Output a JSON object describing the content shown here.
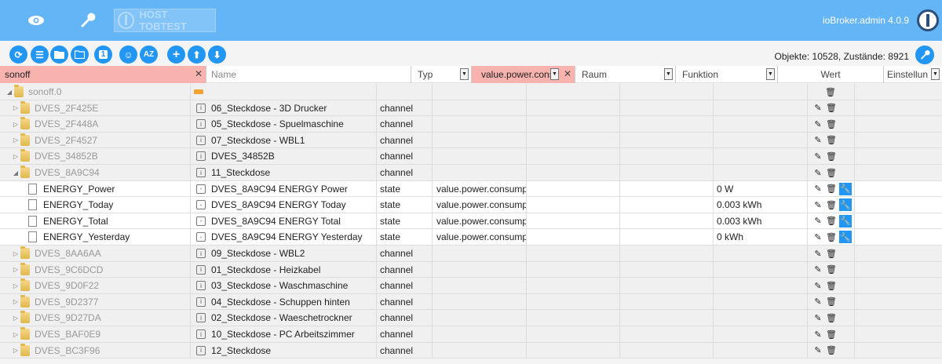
{
  "header": {
    "host_label": "HOST TOBTEST",
    "version": "ioBroker.admin 4.0.9",
    "icons": [
      "eye-icon",
      "wrench-icon"
    ]
  },
  "toolbar": {
    "buttons": [
      "refresh-icon",
      "list-icon",
      "folder-icon",
      "folder-outline-icon",
      "one-icon",
      "user-settings-icon",
      "sort-az-icon",
      "add-icon",
      "upload-icon",
      "download-icon"
    ],
    "sort_label": "AZ",
    "one_label": "1",
    "stats": "Objekte: 10528, Zustände: 8921"
  },
  "filters": {
    "id_value": "sonoff",
    "name_placeholder": "Name",
    "type_label": "Typ",
    "role_value": "value.power.consu",
    "room_label": "Raum",
    "function_label": "Funktion",
    "value_label": "Wert",
    "settings_label": "Einstellun"
  },
  "root": {
    "id": "sonoff.0"
  },
  "rows": [
    {
      "id": "DVES_2F425E",
      "name": "06_Steckdose - 3D Drucker",
      "type": "channel",
      "role": "",
      "value": "",
      "kind": "folder",
      "expanded": false
    },
    {
      "id": "DVES_2F448A",
      "name": "05_Steckdose - Spuelmaschine",
      "type": "channel",
      "role": "",
      "value": "",
      "kind": "folder",
      "expanded": false
    },
    {
      "id": "DVES_2F4527",
      "name": "07_Steckdose - WBL1",
      "type": "channel",
      "role": "",
      "value": "",
      "kind": "folder",
      "expanded": false
    },
    {
      "id": "DVES_34852B",
      "name": "DVES_34852B",
      "type": "channel",
      "role": "",
      "value": "",
      "kind": "folder",
      "expanded": false
    },
    {
      "id": "DVES_8A9C94",
      "name": "11_Steckdose",
      "type": "channel",
      "role": "",
      "value": "",
      "kind": "folder",
      "expanded": true
    },
    {
      "id": "ENERGY_Power",
      "name": "DVES_8A9C94 ENERGY Power",
      "type": "state",
      "role": "value.power.consumptio",
      "value": "0 W",
      "kind": "file"
    },
    {
      "id": "ENERGY_Today",
      "name": "DVES_8A9C94 ENERGY Today",
      "type": "state",
      "role": "value.power.consumptio",
      "value": "0.003 kWh",
      "kind": "file"
    },
    {
      "id": "ENERGY_Total",
      "name": "DVES_8A9C94 ENERGY Total",
      "type": "state",
      "role": "value.power.consumptio",
      "value": "0.003 kWh",
      "kind": "file"
    },
    {
      "id": "ENERGY_Yesterday",
      "name": "DVES_8A9C94 ENERGY Yesterday",
      "type": "state",
      "role": "value.power.consumptio",
      "value": "0 kWh",
      "kind": "file"
    },
    {
      "id": "DVES_8AA6AA",
      "name": "09_Steckdose - WBL2",
      "type": "channel",
      "role": "",
      "value": "",
      "kind": "folder",
      "expanded": false
    },
    {
      "id": "DVES_9C6DCD",
      "name": "01_Steckdose - Heizkabel",
      "type": "channel",
      "role": "",
      "value": "",
      "kind": "folder",
      "expanded": false
    },
    {
      "id": "DVES_9D0F22",
      "name": "03_Steckdose - Waschmaschine",
      "type": "channel",
      "role": "",
      "value": "",
      "kind": "folder",
      "expanded": false
    },
    {
      "id": "DVES_9D2377",
      "name": "04_Steckdose - Schuppen hinten",
      "type": "channel",
      "role": "",
      "value": "",
      "kind": "folder",
      "expanded": false
    },
    {
      "id": "DVES_9D27DA",
      "name": "02_Steckdose - Waeschetrockner",
      "type": "channel",
      "role": "",
      "value": "",
      "kind": "folder",
      "expanded": false
    },
    {
      "id": "DVES_BAF0E9",
      "name": "10_Steckdose - PC Arbeitszimmer",
      "type": "channel",
      "role": "",
      "value": "",
      "kind": "folder",
      "expanded": false
    },
    {
      "id": "DVES_BC3F96",
      "name": "12_Steckdose",
      "type": "channel",
      "role": "",
      "value": "",
      "kind": "folder",
      "expanded": false
    }
  ]
}
